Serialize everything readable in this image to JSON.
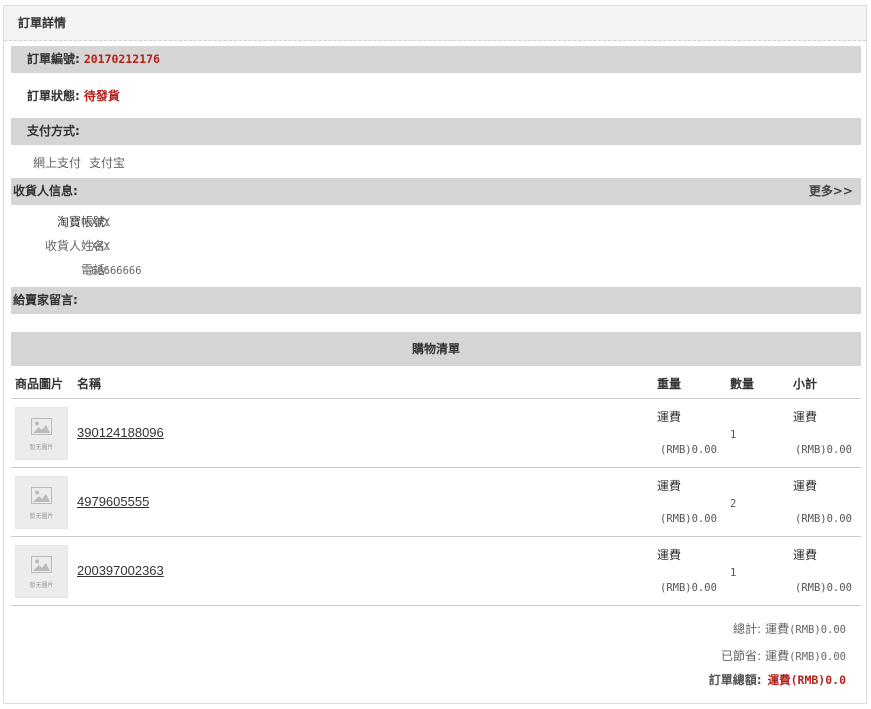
{
  "panel": {
    "title": "訂單詳情"
  },
  "order": {
    "number_label": "訂單編號:",
    "number_value": "20170212176",
    "status_label": "訂單狀態:",
    "status_value": "待發貨"
  },
  "payment": {
    "section_label": "支付方式:",
    "method_label": "網上支付",
    "method_value": "支付宝"
  },
  "receiver": {
    "section_label": "收貨人信息:",
    "more_link": "更多>>",
    "fields": [
      {
        "label": "淘寶帳號:",
        "value": "XXX"
      },
      {
        "label": "收貨人姓名:",
        "value": "XXX"
      },
      {
        "label": "電話:",
        "value": "66666666"
      }
    ]
  },
  "message": {
    "section_label": "給賣家留言:"
  },
  "cart": {
    "title": "購物清單",
    "headers": {
      "image": "商品圖片",
      "name": "名稱",
      "weight": "重量",
      "qty": "數量",
      "subtotal": "小計"
    },
    "thumb_caption": "暂无圖片",
    "items": [
      {
        "name": "390124188096",
        "weight_label": "運費",
        "weight_price": "(RMB)0.00",
        "qty": "1",
        "subtotal_label": "運費",
        "subtotal_price": "(RMB)0.00"
      },
      {
        "name": "4979605555",
        "weight_label": "運費",
        "weight_price": "(RMB)0.00",
        "qty": "2",
        "subtotal_label": "運費",
        "subtotal_price": "(RMB)0.00"
      },
      {
        "name": "200397002363",
        "weight_label": "運費",
        "weight_price": "(RMB)0.00",
        "qty": "1",
        "subtotal_label": "運費",
        "subtotal_price": "(RMB)0.00"
      }
    ]
  },
  "summary": {
    "total_label": "總計:",
    "total_value_label": "運費",
    "total_value": "(RMB)0.00",
    "saved_label": "已節省:",
    "saved_value_label": "運費",
    "saved_value": "(RMB)0.00",
    "grand_label": "訂單總額:",
    "grand_value": "運費(RMB)0.0"
  },
  "colors": {
    "accent_red": "#b5201a",
    "bar_grey": "#d5d5d5"
  }
}
